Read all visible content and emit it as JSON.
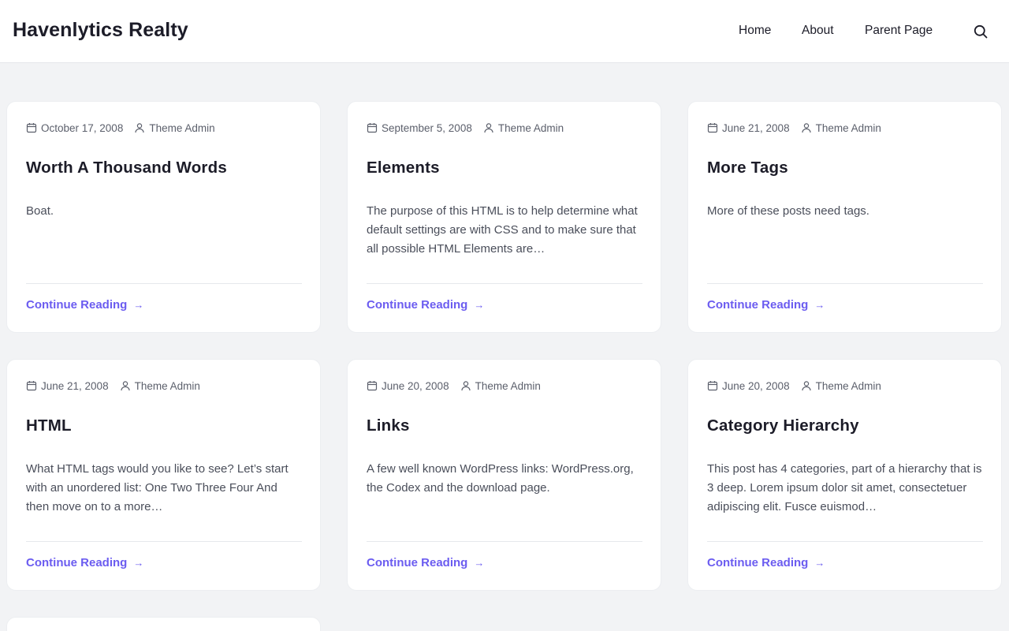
{
  "site": {
    "title": "Havenlytics Realty"
  },
  "nav": {
    "items": [
      "Home",
      "About",
      "Parent Page"
    ]
  },
  "icons": {
    "search": "search-icon",
    "date": "calendar-icon",
    "author": "user-icon",
    "arrow": "arrow-right-icon"
  },
  "colors": {
    "accent": "#6b5cf0",
    "background": "#f2f3f5",
    "card": "#ffffff",
    "text": "#1c1c28"
  },
  "posts": [
    {
      "date": "October 17, 2008",
      "author": "Theme Admin",
      "title": "Worth A Thousand Words",
      "excerpt": "Boat.",
      "more": "Continue Reading",
      "arrow": "→"
    },
    {
      "date": "September 5, 2008",
      "author": "Theme Admin",
      "title": "Elements",
      "excerpt": "The purpose of this HTML is to help determine what default settings are with CSS and to make sure that all possible HTML Elements are…",
      "more": "Continue Reading",
      "arrow": "→"
    },
    {
      "date": "June 21, 2008",
      "author": "Theme Admin",
      "title": "More Tags",
      "excerpt": "More of these posts need tags.",
      "more": "Continue Reading",
      "arrow": "→"
    },
    {
      "date": "June 21, 2008",
      "author": "Theme Admin",
      "title": "HTML",
      "excerpt": "What HTML tags would you like to see? Let’s start with an unordered list: One Two Three Four And then move on to a more…",
      "more": "Continue Reading",
      "arrow": "→"
    },
    {
      "date": "June 20, 2008",
      "author": "Theme Admin",
      "title": "Links",
      "excerpt": "A few well known WordPress links: WordPress.org, the Codex and the download page.",
      "more": "Continue Reading",
      "arrow": "→"
    },
    {
      "date": "June 20, 2008",
      "author": "Theme Admin",
      "title": "Category Hierarchy",
      "excerpt": "This post has 4 categories, part of a hierarchy that is 3 deep. Lorem ipsum dolor sit amet, consectetuer adipiscing elit. Fusce euismod…",
      "more": "Continue Reading",
      "arrow": "→"
    }
  ]
}
